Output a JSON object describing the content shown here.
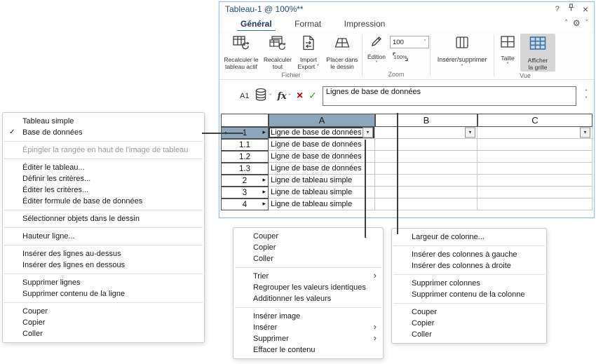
{
  "colors": {
    "accent": "#2E75B6",
    "selection_header": "#8EA6BA",
    "window_border": "#9CC0E4",
    "title_text": "#1F4E79",
    "cancel_red": "#C00000",
    "confirm_green": "#37A03C"
  },
  "icons": {
    "help": "?",
    "close": "×",
    "chevron_up": "˄",
    "chevron_down": "˅",
    "gear": "⚙",
    "dropdown": "▾",
    "row_arrow": "▸",
    "row_marker": "◆",
    "check": "✓",
    "cancel": "×",
    "confirm": "✓",
    "submenu": "›",
    "fx": "fx"
  },
  "window": {
    "title": "Tableau-1 @ 100%**"
  },
  "tabs": {
    "general": "Général",
    "format": "Format",
    "impression": "Impression"
  },
  "ribbon": {
    "groups": {
      "fichier": "Fichier",
      "zoom": "Zoom",
      "vue": "Vue"
    },
    "recalc_active": "Recalculer le\ntableau actif",
    "recalc_all": "Recalculer\ntout",
    "import_export": "Import\nExport",
    "place_drawing": "Placer dans\nle dessin",
    "edition": "Édition",
    "zoom_value": "100",
    "zoom_icon_label": "100%",
    "insert_delete": "Insérer/supprimer",
    "size": "Taille",
    "show_grid": "Afficher\nla grille"
  },
  "formula_bar": {
    "cell_ref": "A1",
    "value": "Lignes de base de données"
  },
  "grid": {
    "col_headers": [
      "A",
      "B",
      "C"
    ],
    "rows": [
      {
        "num": "1",
        "a": "Ligne de base de données"
      },
      {
        "num": "1.1",
        "a": "Ligne de base de données"
      },
      {
        "num": "1.2",
        "a": "Ligne de base de données"
      },
      {
        "num": "1.3",
        "a": "Ligne de base de données"
      },
      {
        "num": "2",
        "a": "Ligne de tableau simple"
      },
      {
        "num": "3",
        "a": "Ligne de tableau simple"
      },
      {
        "num": "4",
        "a": "Ligne de tableau simple"
      }
    ]
  },
  "menus": {
    "row_menu": {
      "items": [
        {
          "label": "Tableau simple"
        },
        {
          "label": "Base de données",
          "checked": true
        },
        {
          "sep": true
        },
        {
          "label": "Épingler la rangée en haut de l'image de tableau",
          "disabled": true
        },
        {
          "sep": true
        },
        {
          "label": "Éditer le tableau..."
        },
        {
          "label": "Définir les critères..."
        },
        {
          "label": "Éditer les critères..."
        },
        {
          "label": "Éditer formule de base de données"
        },
        {
          "sep": true
        },
        {
          "label": "Sélectionner objets dans le dessin"
        },
        {
          "sep": true
        },
        {
          "label": "Hauteur ligne..."
        },
        {
          "sep": true
        },
        {
          "label": "Insérer des lignes au-dessus"
        },
        {
          "label": "Insérer des lignes en dessous"
        },
        {
          "sep": true
        },
        {
          "label": "Supprimer lignes"
        },
        {
          "label": "Supprimer contenu de la ligne"
        },
        {
          "sep": true
        },
        {
          "label": "Couper"
        },
        {
          "label": "Copier"
        },
        {
          "label": "Coller"
        }
      ]
    },
    "cell_menu": {
      "items": [
        {
          "label": "Couper"
        },
        {
          "label": "Copier"
        },
        {
          "label": "Coller"
        },
        {
          "sep": true
        },
        {
          "label": "Trier",
          "submenu": true
        },
        {
          "label": "Regrouper les valeurs identiques"
        },
        {
          "label": "Additionner les valeurs"
        },
        {
          "sep": true
        },
        {
          "label": "Insérer image"
        },
        {
          "label": "Insérer",
          "submenu": true
        },
        {
          "label": "Supprimer",
          "submenu": true
        },
        {
          "label": "Effacer le contenu"
        }
      ]
    },
    "column_menu": {
      "items": [
        {
          "label": "Largeur de colonne..."
        },
        {
          "sep": true
        },
        {
          "label": "Insérer des colonnes à gauche"
        },
        {
          "label": "Insérer des colonnes à droite"
        },
        {
          "sep": true
        },
        {
          "label": "Supprimer colonnes"
        },
        {
          "label": "Supprimer contenu de la colonne"
        },
        {
          "sep": true
        },
        {
          "label": "Couper"
        },
        {
          "label": "Copier"
        },
        {
          "label": "Coller"
        }
      ]
    }
  }
}
